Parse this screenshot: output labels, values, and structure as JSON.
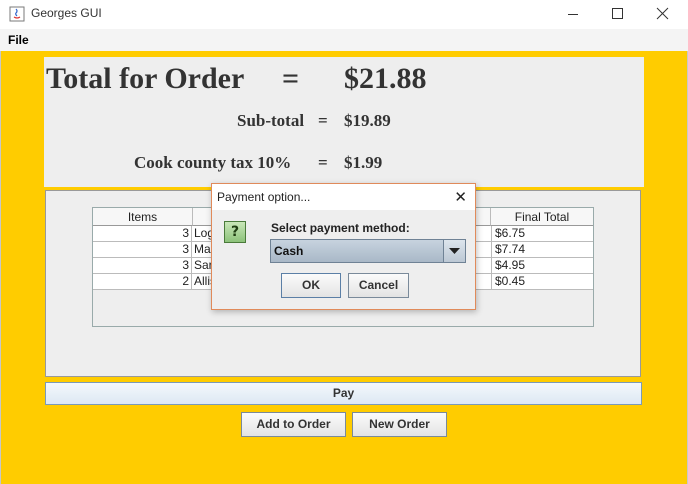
{
  "window": {
    "title": "Georges GUI"
  },
  "menu": {
    "file": "File"
  },
  "summary": {
    "total_label": "Total for Order",
    "total_eq": "=",
    "total_value": "$21.88",
    "subtotal_label": "Sub-total",
    "subtotal_eq": "=",
    "subtotal_value": "$19.89",
    "tax_label": "Cook county tax 10%",
    "tax_eq": "=",
    "tax_value": "$1.99"
  },
  "table": {
    "headers": [
      "Items",
      "",
      "Final Total"
    ],
    "rows": [
      {
        "qty": "3",
        "name": "Log",
        "total": "$6.75"
      },
      {
        "qty": "3",
        "name": "Ma",
        "total": "$7.74"
      },
      {
        "qty": "3",
        "name": "Sar",
        "total": "$4.95"
      },
      {
        "qty": "2",
        "name": "Allis",
        "total": "$0.45"
      }
    ]
  },
  "buttons": {
    "pay": "Pay",
    "add": "Add to Order",
    "new": "New Order"
  },
  "dialog": {
    "title": "Payment option...",
    "prompt": "Select payment method:",
    "selected": "Cash",
    "ok": "OK",
    "cancel": "Cancel"
  },
  "colors": {
    "background": "#ffcc00",
    "panel": "#eeeeee",
    "dialog_border": "#e08a5a"
  },
  "icons": {
    "app": "java-icon",
    "question": "question-icon"
  }
}
